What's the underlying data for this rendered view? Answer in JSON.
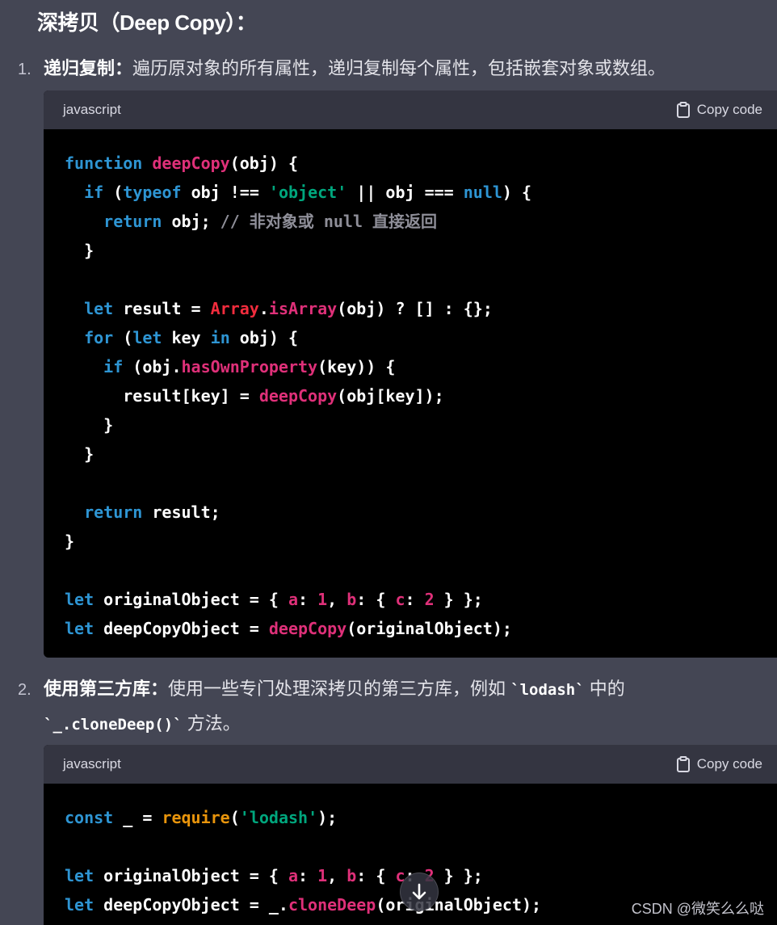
{
  "heading": "深拷贝（Deep Copy）：",
  "items": [
    {
      "number": "1.",
      "title": "递归复制：",
      "text": "遍历原对象的所有属性，递归复制每个属性，包括嵌套对象或数组。"
    },
    {
      "number": "2.",
      "title": "使用第三方库：",
      "text_before": "使用一些专门处理深拷贝的第三方库，例如 ",
      "code1": "`lodash`",
      "text_middle": " 中的",
      "code2": "`_.cloneDeep()`",
      "text_after": " 方法。"
    }
  ],
  "code_blocks": [
    {
      "language": "javascript",
      "copy_label": "Copy code",
      "lines": [
        [
          [
            "kw",
            "function"
          ],
          [
            "p",
            " "
          ],
          [
            "fn",
            "deepCopy"
          ],
          [
            "p",
            "(obj) {"
          ]
        ],
        [
          [
            "p",
            "  "
          ],
          [
            "kw",
            "if"
          ],
          [
            "p",
            " ("
          ],
          [
            "kw",
            "typeof"
          ],
          [
            "p",
            " obj !== "
          ],
          [
            "str",
            "'object'"
          ],
          [
            "p",
            " || obj === "
          ],
          [
            "kw",
            "null"
          ],
          [
            "p",
            ") {"
          ]
        ],
        [
          [
            "p",
            "    "
          ],
          [
            "kw",
            "return"
          ],
          [
            "p",
            " obj; "
          ],
          [
            "cm",
            "// 非对象或 null 直接返回"
          ]
        ],
        [
          [
            "p",
            "  }"
          ]
        ],
        [
          [
            "p",
            ""
          ]
        ],
        [
          [
            "p",
            "  "
          ],
          [
            "kw",
            "let"
          ],
          [
            "p",
            " result = "
          ],
          [
            "arr",
            "Array"
          ],
          [
            "p",
            "."
          ],
          [
            "fn",
            "isArray"
          ],
          [
            "p",
            "(obj) ? [] : {};"
          ]
        ],
        [
          [
            "p",
            "  "
          ],
          [
            "kw",
            "for"
          ],
          [
            "p",
            " ("
          ],
          [
            "kw",
            "let"
          ],
          [
            "p",
            " key "
          ],
          [
            "kw",
            "in"
          ],
          [
            "p",
            " obj) {"
          ]
        ],
        [
          [
            "p",
            "    "
          ],
          [
            "kw",
            "if"
          ],
          [
            "p",
            " (obj."
          ],
          [
            "fn",
            "hasOwnProperty"
          ],
          [
            "p",
            "(key)) {"
          ]
        ],
        [
          [
            "p",
            "      result[key] = "
          ],
          [
            "fn",
            "deepCopy"
          ],
          [
            "p",
            "(obj[key]);"
          ]
        ],
        [
          [
            "p",
            "    }"
          ]
        ],
        [
          [
            "p",
            "  }"
          ]
        ],
        [
          [
            "p",
            ""
          ]
        ],
        [
          [
            "p",
            "  "
          ],
          [
            "kw",
            "return"
          ],
          [
            "p",
            " result;"
          ]
        ],
        [
          [
            "p",
            "}"
          ]
        ],
        [
          [
            "p",
            ""
          ]
        ],
        [
          [
            "kw",
            "let"
          ],
          [
            "p",
            " originalObject = { "
          ],
          [
            "num",
            "a"
          ],
          [
            "p",
            ": "
          ],
          [
            "num",
            "1"
          ],
          [
            "p",
            ", "
          ],
          [
            "num",
            "b"
          ],
          [
            "p",
            ": { "
          ],
          [
            "num",
            "c"
          ],
          [
            "p",
            ": "
          ],
          [
            "num",
            "2"
          ],
          [
            "p",
            " } };"
          ]
        ],
        [
          [
            "kw",
            "let"
          ],
          [
            "p",
            " deepCopyObject = "
          ],
          [
            "fn",
            "deepCopy"
          ],
          [
            "p",
            "(originalObject);"
          ]
        ]
      ]
    },
    {
      "language": "javascript",
      "copy_label": "Copy code",
      "lines": [
        [
          [
            "kw",
            "const"
          ],
          [
            "p",
            " _ = "
          ],
          [
            "req",
            "require"
          ],
          [
            "p",
            "("
          ],
          [
            "str",
            "'lodash'"
          ],
          [
            "p",
            ");"
          ]
        ],
        [
          [
            "p",
            ""
          ]
        ],
        [
          [
            "kw",
            "let"
          ],
          [
            "p",
            " originalObject = { "
          ],
          [
            "num",
            "a"
          ],
          [
            "p",
            ": "
          ],
          [
            "num",
            "1"
          ],
          [
            "p",
            ", "
          ],
          [
            "num",
            "b"
          ],
          [
            "p",
            ": { "
          ],
          [
            "num",
            "c"
          ],
          [
            "p",
            ": "
          ],
          [
            "num",
            "2"
          ],
          [
            "p",
            " } };"
          ]
        ],
        [
          [
            "kw",
            "let"
          ],
          [
            "p",
            " deepCopyObject = _."
          ],
          [
            "fn",
            "cloneDeep"
          ],
          [
            "p",
            "(originalObject);"
          ]
        ]
      ]
    }
  ],
  "scroll_icon": "arrow-down-icon",
  "watermark": "CSDN @微笑么么哒",
  "colors": {
    "background": "#444654",
    "code_bg": "#000000",
    "code_header_bg": "#343541",
    "keyword": "#2e95d3",
    "function": "#df3079",
    "string": "#00a67d",
    "require": "#e9950c"
  }
}
